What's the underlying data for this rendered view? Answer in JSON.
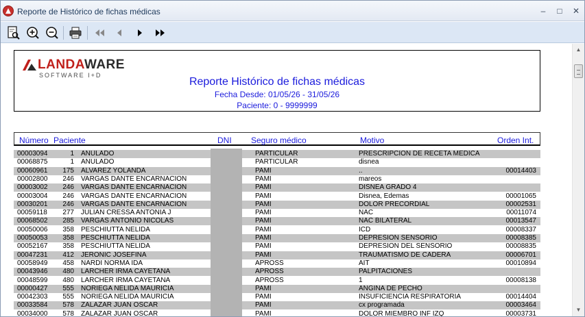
{
  "window": {
    "title": "Reporte de Histórico de fichas médicas",
    "controls": {
      "minimize": "–",
      "maximize": "□",
      "close": "✕"
    }
  },
  "toolbar": {
    "buttons": [
      "preview-icon",
      "zoom-in-icon",
      "zoom-out-icon",
      "print-icon",
      "first-page-icon",
      "previous-page-icon",
      "next-page-icon",
      "last-page-icon"
    ]
  },
  "report": {
    "logo": {
      "name_red": "LANDA",
      "name_dark": "WARE",
      "tagline": "SOFTWARE I+D"
    },
    "title": "Reporte Histórico de fichas médicas",
    "fecha": "Fecha Desde: 01/05/26 - 31/05/26",
    "paciente": "Paciente: 0 - 9999999",
    "columns": {
      "numero": "Número",
      "paciente": "Paciente",
      "dni": "DNI",
      "seguro": "Seguro médico",
      "motivo": "Motivo",
      "orden": "Orden Int."
    },
    "rows": [
      {
        "numero": "00003094",
        "code": "1",
        "name": "ANULADO",
        "seguro": "PARTICULAR",
        "motivo": "PRESCRIPCION DE RECETA MEDICA",
        "orden": ""
      },
      {
        "numero": "00068875",
        "code": "1",
        "name": "ANULADO",
        "seguro": "PARTICULAR",
        "motivo": "disnea",
        "orden": ""
      },
      {
        "numero": "00060961",
        "code": "175",
        "name": "ALVAREZ YOLANDA",
        "seguro": "PAMI",
        "motivo": "..",
        "orden": "00014403"
      },
      {
        "numero": "00002800",
        "code": "246",
        "name": "VARGAS DANTE ENCARNACION",
        "seguro": "PAMI",
        "motivo": "mareos",
        "orden": ""
      },
      {
        "numero": "00003002",
        "code": "246",
        "name": "VARGAS DANTE ENCARNACION",
        "seguro": "PAMI",
        "motivo": "DISNEA GRADO 4",
        "orden": ""
      },
      {
        "numero": "00003004",
        "code": "246",
        "name": "VARGAS DANTE ENCARNACION",
        "seguro": "PAMI",
        "motivo": "Disnea, Edemas",
        "orden": "00001065"
      },
      {
        "numero": "00030201",
        "code": "246",
        "name": "VARGAS DANTE ENCARNACION",
        "seguro": "PAMI",
        "motivo": "DOLOR PRECORDIAL",
        "orden": "00002531"
      },
      {
        "numero": "00059118",
        "code": "277",
        "name": "JULIAN CRESSA ANTONIA J",
        "seguro": "PAMI",
        "motivo": "NAC",
        "orden": "00011074"
      },
      {
        "numero": "00068502",
        "code": "285",
        "name": "VARGAS ANTONIO NICOLAS",
        "seguro": "PAMI",
        "motivo": "NAC BILATERAL",
        "orden": "00013547"
      },
      {
        "numero": "00050006",
        "code": "358",
        "name": "PESCHIUTTA NELIDA",
        "seguro": "PAMI",
        "motivo": "ICD",
        "orden": "00008337"
      },
      {
        "numero": "00050053",
        "code": "358",
        "name": "PESCHIUTTA NELIDA",
        "seguro": "PAMI",
        "motivo": "DEPRESION SENSORIO",
        "orden": "00008385"
      },
      {
        "numero": "00052167",
        "code": "358",
        "name": "PESCHIUTTA NELIDA",
        "seguro": "PAMI",
        "motivo": "DEPRESION DEL SENSORIO",
        "orden": "00008835"
      },
      {
        "numero": "00047231",
        "code": "412",
        "name": "JERONIC JOSEFINA",
        "seguro": "PAMI",
        "motivo": "TRAUMATISMO DE CADERA",
        "orden": "00006701"
      },
      {
        "numero": "00058949",
        "code": "458",
        "name": "NARDI NORMA IDA",
        "seguro": "APROSS",
        "motivo": "AIT",
        "orden": "00010894"
      },
      {
        "numero": "00043946",
        "code": "480",
        "name": "LARCHER IRMA CAYETANA",
        "seguro": "APROSS",
        "motivo": "PALPITACIONES",
        "orden": ""
      },
      {
        "numero": "00048599",
        "code": "480",
        "name": "LARCHER IRMA CAYETANA",
        "seguro": "APROSS",
        "motivo": "1",
        "orden": "00008138"
      },
      {
        "numero": "00000427",
        "code": "555",
        "name": "NORIEGA NELIDA MAURICIA",
        "seguro": "PAMI",
        "motivo": "ANGINA DE PECHO",
        "orden": ""
      },
      {
        "numero": "00042303",
        "code": "555",
        "name": "NORIEGA NELIDA MAURICIA",
        "seguro": "PAMI",
        "motivo": "INSUFICIENCIA RESPIRATORIA",
        "orden": "00014404"
      },
      {
        "numero": "00033584",
        "code": "578",
        "name": "ZALAZAR JUAN OSCAR",
        "seguro": "PAMI",
        "motivo": "cx programada",
        "orden": "00003464"
      },
      {
        "numero": "00034000",
        "code": "578",
        "name": "ZALAZAR JUAN OSCAR",
        "seguro": "PAMI",
        "motivo": "DOLOR MIEMBRO INF IZQ",
        "orden": "00003731"
      }
    ]
  }
}
